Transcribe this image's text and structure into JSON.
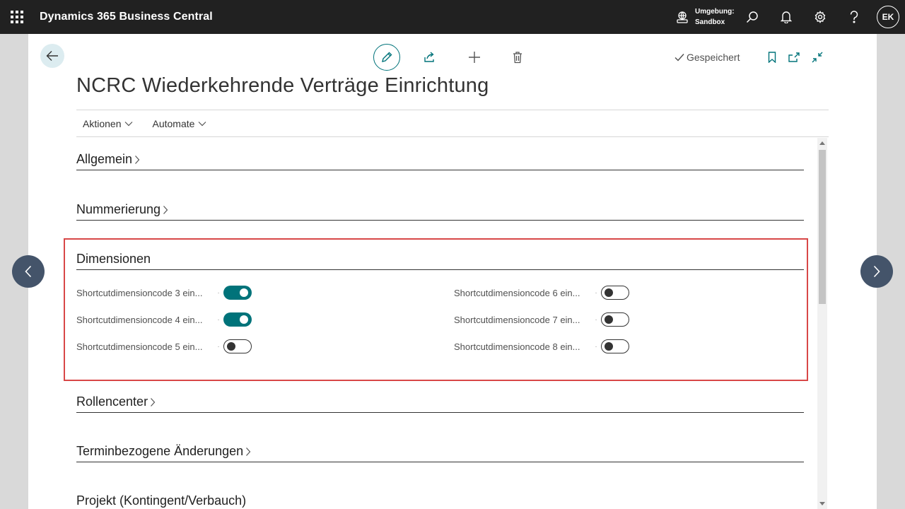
{
  "topbar": {
    "app_title": "Dynamics 365 Business Central",
    "env_label": "Umgebung:",
    "env_value": "Sandbox",
    "user_initials": "EK"
  },
  "page": {
    "title": "NCRC Wiederkehrende Verträge Einrichtung",
    "saved_label": "Gespeichert",
    "menu": [
      {
        "label": "Aktionen"
      },
      {
        "label": "Automate"
      }
    ]
  },
  "sections": {
    "allgemein": "Allgemein",
    "nummerierung": "Nummerierung",
    "dimensionen": "Dimensionen",
    "rollencenter": "Rollencenter",
    "terminbezogen": "Terminbezogene Änderungen",
    "projekt": "Projekt (Kontingent/Verbauch)"
  },
  "dimension_fields": [
    {
      "label": "Shortcutdimensioncode 3 ein...",
      "value": true
    },
    {
      "label": "Shortcutdimensioncode 4 ein...",
      "value": true
    },
    {
      "label": "Shortcutdimensioncode 5 ein...",
      "value": false
    },
    {
      "label": "Shortcutdimensioncode 6 ein...",
      "value": false
    },
    {
      "label": "Shortcutdimensioncode 7 ein...",
      "value": false
    },
    {
      "label": "Shortcutdimensioncode 8 ein...",
      "value": false
    }
  ],
  "colors": {
    "accent": "#00737a",
    "highlight": "#d84747",
    "topbar": "#212121"
  }
}
